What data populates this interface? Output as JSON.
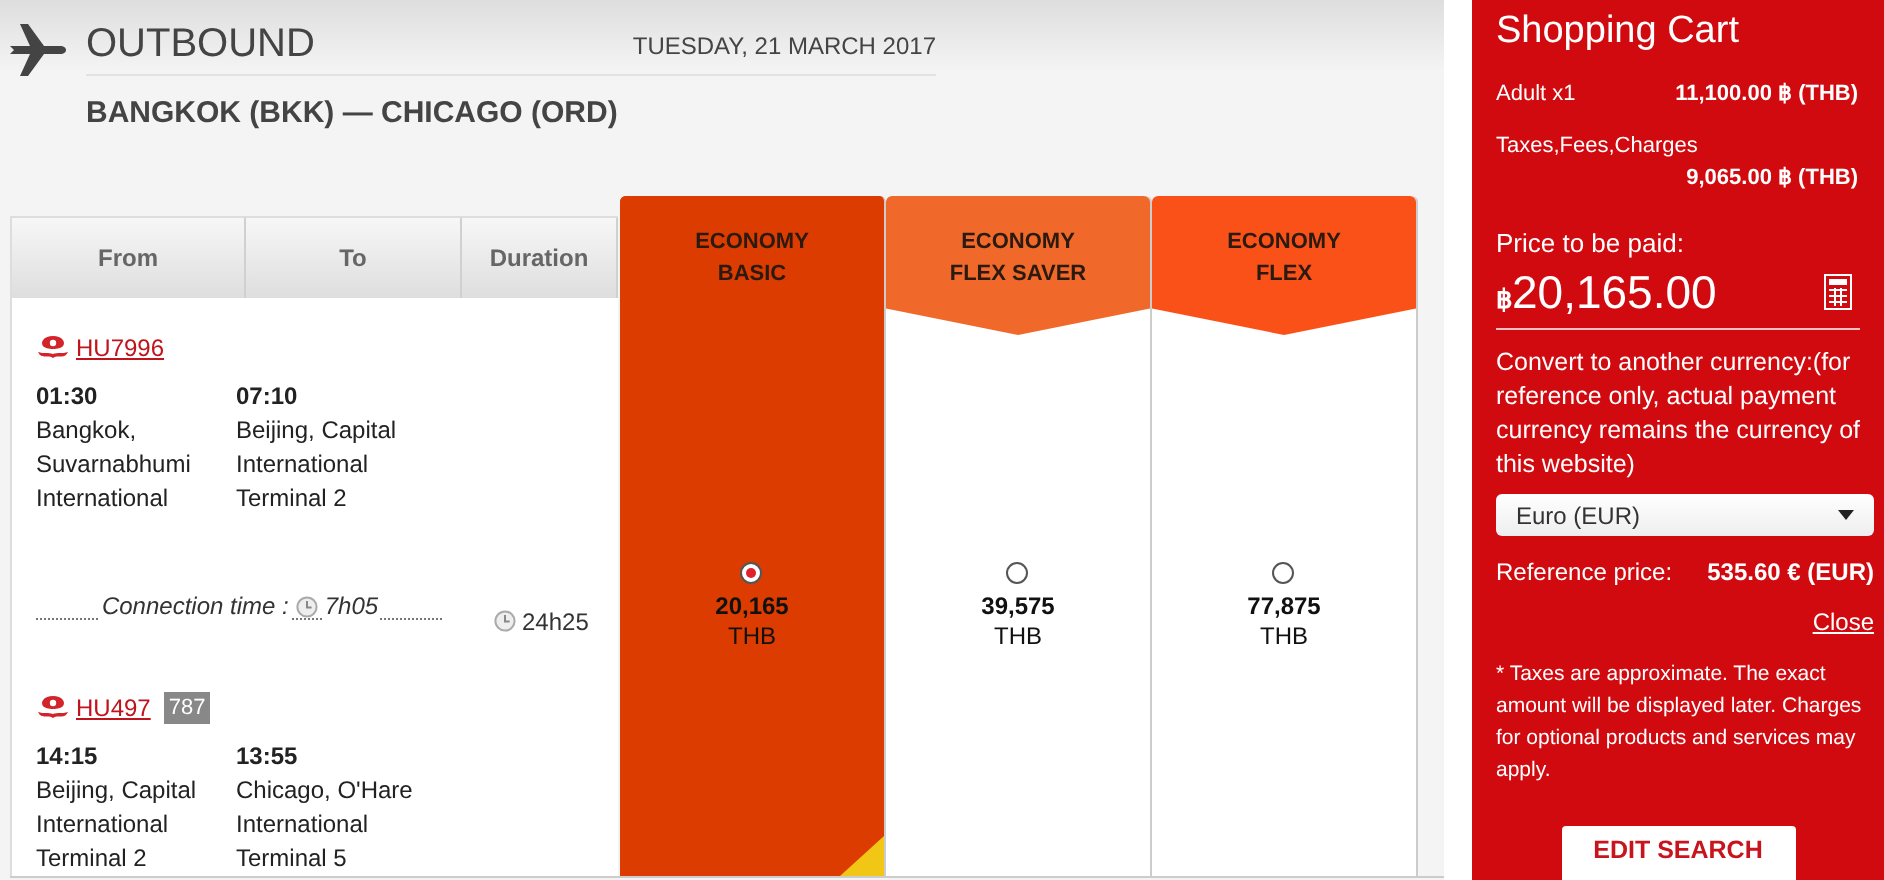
{
  "header": {
    "title": "OUTBOUND",
    "date": "TUESDAY, 21 MARCH 2017",
    "route": "BANGKOK (BKK) — CHICAGO (ORD)"
  },
  "table": {
    "columns": [
      "From",
      "To",
      "Duration"
    ],
    "segments": [
      {
        "flight": "HU7996",
        "dep_time": "01:30",
        "dep_place": "Bangkok, Suvarnabhumi International",
        "arr_time": "07:10",
        "arr_place": "Beijing, Capital International Terminal 2"
      },
      {
        "flight": "HU497",
        "aircraft": "787",
        "dep_time": "14:15",
        "dep_place": "Beijing, Capital International Terminal 2",
        "arr_time": "13:55",
        "arr_place": "Chicago, O'Hare International Terminal 5"
      }
    ],
    "connection": {
      "label": "Connection time :",
      "time": "7h05"
    },
    "duration": "24h25"
  },
  "fares": [
    {
      "label_lines": [
        "ECONOMY",
        "BASIC"
      ],
      "price": "20,165",
      "currency": "THB",
      "selected": true,
      "color": "#dc3c00"
    },
    {
      "label_lines": [
        "ECONOMY",
        "FLEX SAVER"
      ],
      "price": "39,575",
      "currency": "THB",
      "selected": false,
      "color": "#f0692a"
    },
    {
      "label_lines": [
        "ECONOMY",
        "FLEX"
      ],
      "price": "77,875",
      "currency": "THB",
      "selected": false,
      "color": "#fa5119"
    }
  ],
  "cart": {
    "title": "Shopping Cart",
    "lines": [
      {
        "label": "Adult x1",
        "amount": "11,100.00 ฿ (THB)"
      },
      {
        "label": "Taxes,Fees,Charges",
        "amount": "9,065.00 ฿ (THB)"
      }
    ],
    "price_label": "Price to be paid:",
    "currency_symbol": "฿",
    "total": "20,165.00",
    "convert_note": "Convert to another currency:(for reference only, actual payment currency remains the currency of this website)",
    "currency_select": "Euro (EUR)",
    "reference_label": "Reference price:",
    "reference_value": "535.60 € (EUR)",
    "close": "Close",
    "disclaimer": "* Taxes are approximate. The exact amount will be displayed later. Charges for optional products and services may apply.",
    "button": "EDIT SEARCH"
  }
}
